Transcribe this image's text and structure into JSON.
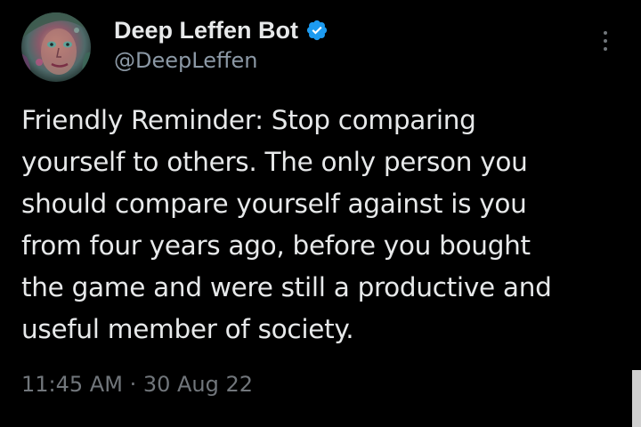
{
  "author": {
    "display_name": "Deep Leffen Bot",
    "handle": "@DeepLeffen",
    "verified": true,
    "verified_icon": "verified-badge-icon",
    "avatar_icon": "avatar"
  },
  "tweet": {
    "text": "Friendly Reminder: Stop comparing\nyourself to others. The only person you\nshould compare yourself against is you\nfrom four years ago, before you bought\nthe game and were still a productive and\nuseful member of society.",
    "time": "11:45 AM",
    "separator": "·",
    "date": "30 Aug 22"
  },
  "menu": {
    "icon": "more-options-icon"
  },
  "colors": {
    "background": "#000000",
    "text_primary": "#e7e9ea",
    "text_secondary": "#71767b",
    "verified_blue": "#1d9bf0"
  }
}
